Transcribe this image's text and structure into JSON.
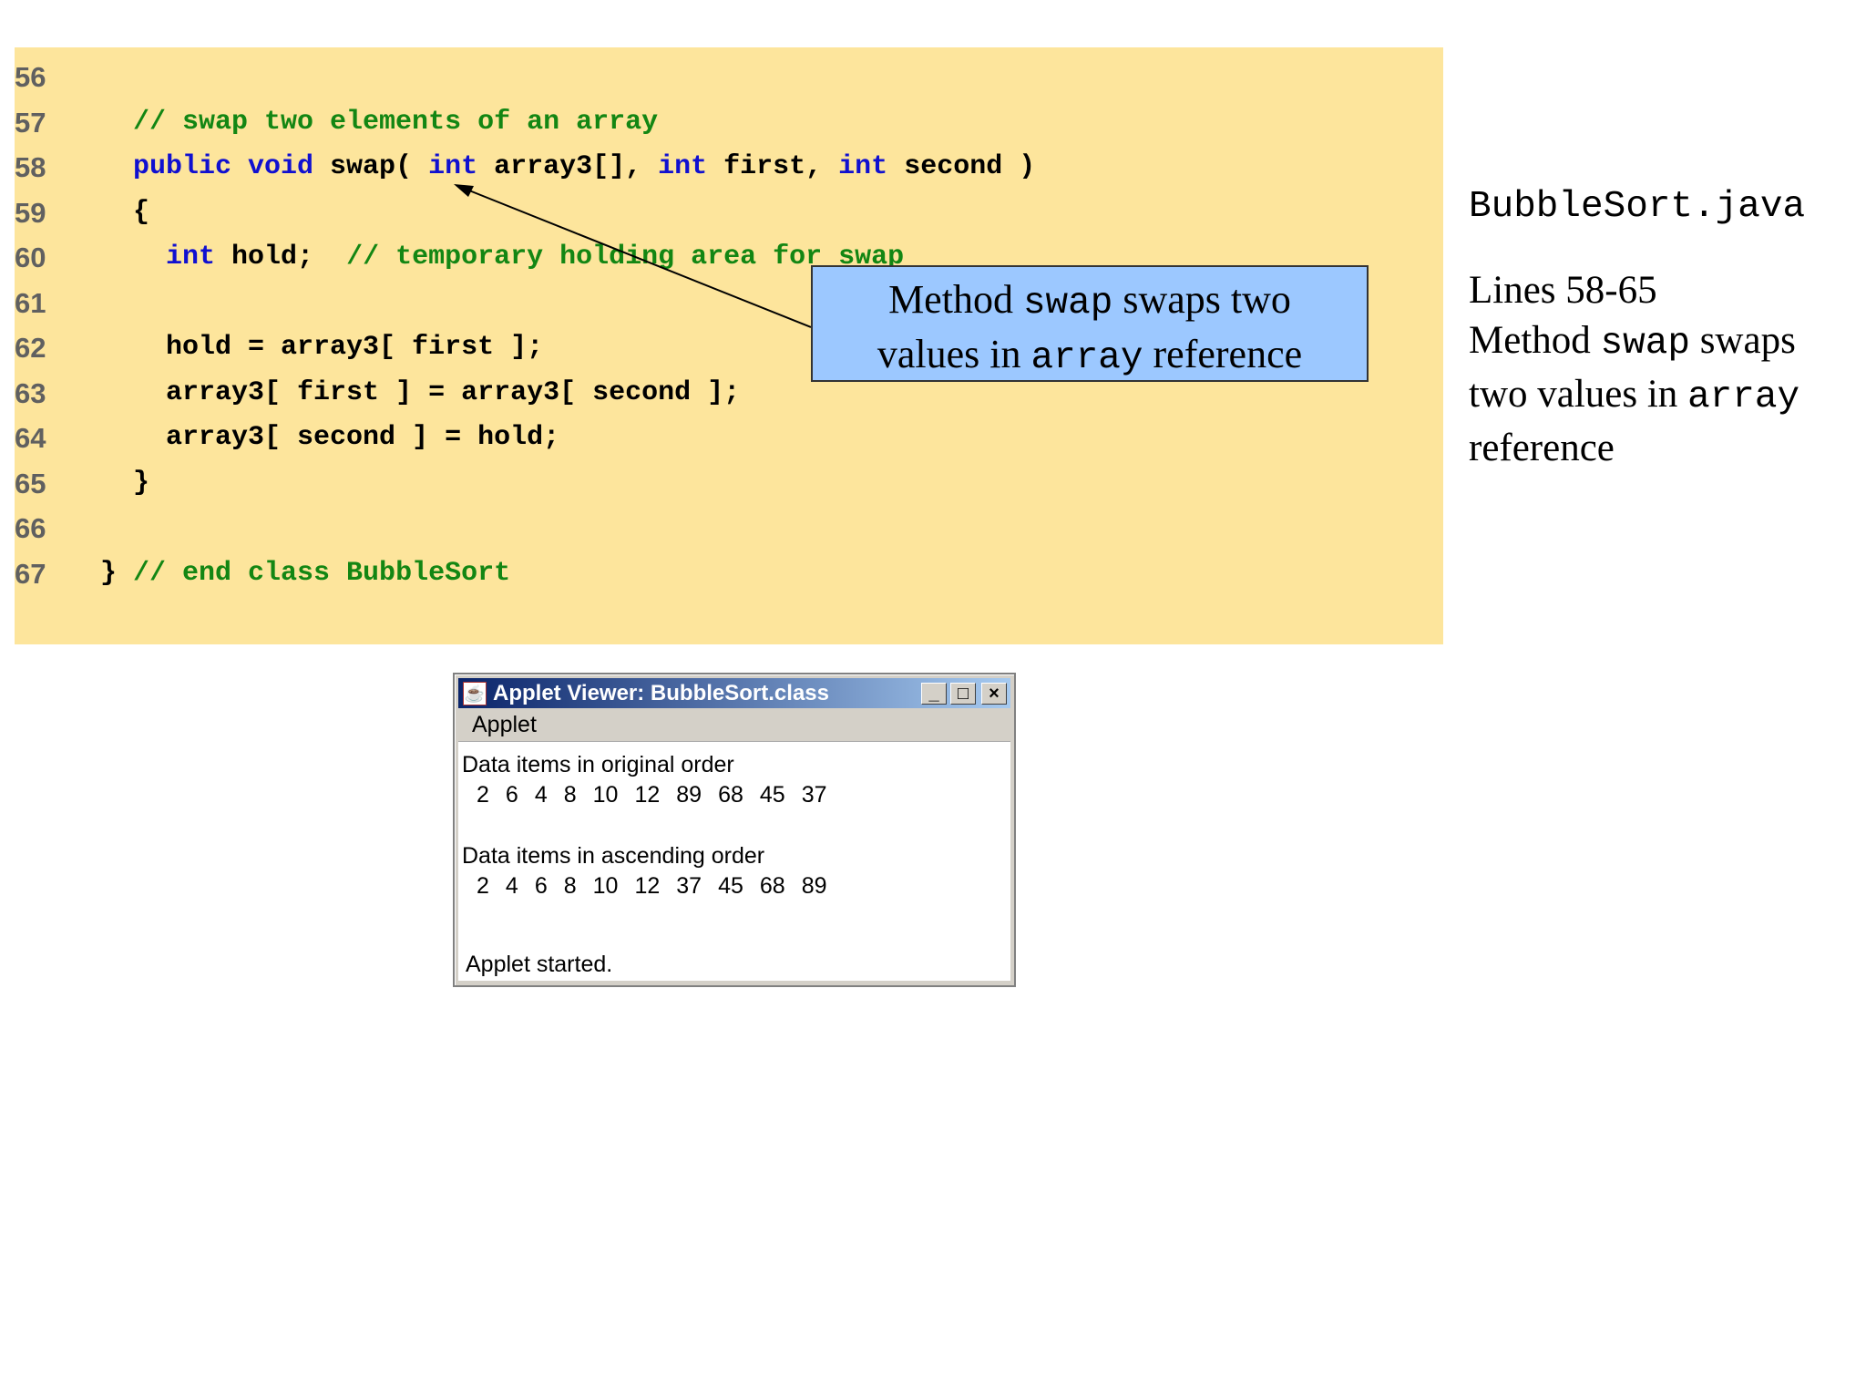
{
  "code": {
    "lines": [
      {
        "num": "56",
        "parts": []
      },
      {
        "num": "57",
        "parts": [
          {
            "t": "cm",
            "s": "    // swap two elements of an array"
          }
        ]
      },
      {
        "num": "58",
        "parts": [
          {
            "t": "kw",
            "s": "    public void "
          },
          {
            "t": "tx",
            "s": "swap( "
          },
          {
            "t": "kw",
            "s": "int "
          },
          {
            "t": "tx",
            "s": "array3[], "
          },
          {
            "t": "kw",
            "s": "int "
          },
          {
            "t": "tx",
            "s": "first, "
          },
          {
            "t": "kw",
            "s": "int "
          },
          {
            "t": "tx",
            "s": "second )"
          }
        ]
      },
      {
        "num": "59",
        "parts": [
          {
            "t": "tx",
            "s": "    {"
          }
        ]
      },
      {
        "num": "60",
        "parts": [
          {
            "t": "kw",
            "s": "      int "
          },
          {
            "t": "tx",
            "s": "hold;  "
          },
          {
            "t": "cm",
            "s": "// temporary holding area for swap"
          }
        ]
      },
      {
        "num": "61",
        "parts": []
      },
      {
        "num": "62",
        "parts": [
          {
            "t": "tx",
            "s": "      hold = array3[ first ];"
          }
        ]
      },
      {
        "num": "63",
        "parts": [
          {
            "t": "tx",
            "s": "      array3[ first ] = array3[ second ];"
          }
        ]
      },
      {
        "num": "64",
        "parts": [
          {
            "t": "tx",
            "s": "      array3[ second ] = hold;"
          }
        ]
      },
      {
        "num": "65",
        "parts": [
          {
            "t": "tx",
            "s": "    }"
          }
        ]
      },
      {
        "num": "66",
        "parts": []
      },
      {
        "num": "67",
        "parts": [
          {
            "t": "tx",
            "s": "  } "
          },
          {
            "t": "cm",
            "s": "// end class BubbleSort"
          }
        ]
      }
    ]
  },
  "callout": {
    "line1_a": "Method ",
    "line1_mono": "swap",
    "line1_b": " swaps two",
    "line2_a": "values in ",
    "line2_mono": "array",
    "line2_b": " reference"
  },
  "side": {
    "file": "BubbleSort.java",
    "lines_label": "Lines 58-65",
    "desc_a": "Method ",
    "desc_mono1": "swap",
    "desc_b": " swaps two values in ",
    "desc_mono2": "array",
    "desc_c": " reference"
  },
  "applet": {
    "title": "Applet Viewer: BubbleSort.class",
    "menu": "Applet",
    "original_label": "Data items in original order",
    "original_values": [
      "2",
      "6",
      "4",
      "8",
      "10",
      "12",
      "89",
      "68",
      "45",
      "37"
    ],
    "sorted_label": "Data items in ascending order",
    "sorted_values": [
      "2",
      "4",
      "6",
      "8",
      "10",
      "12",
      "37",
      "45",
      "68",
      "89"
    ],
    "status": "Applet started.",
    "buttons": {
      "minimize": "_",
      "maximize": "□",
      "close": "×"
    },
    "icon": "☕"
  }
}
